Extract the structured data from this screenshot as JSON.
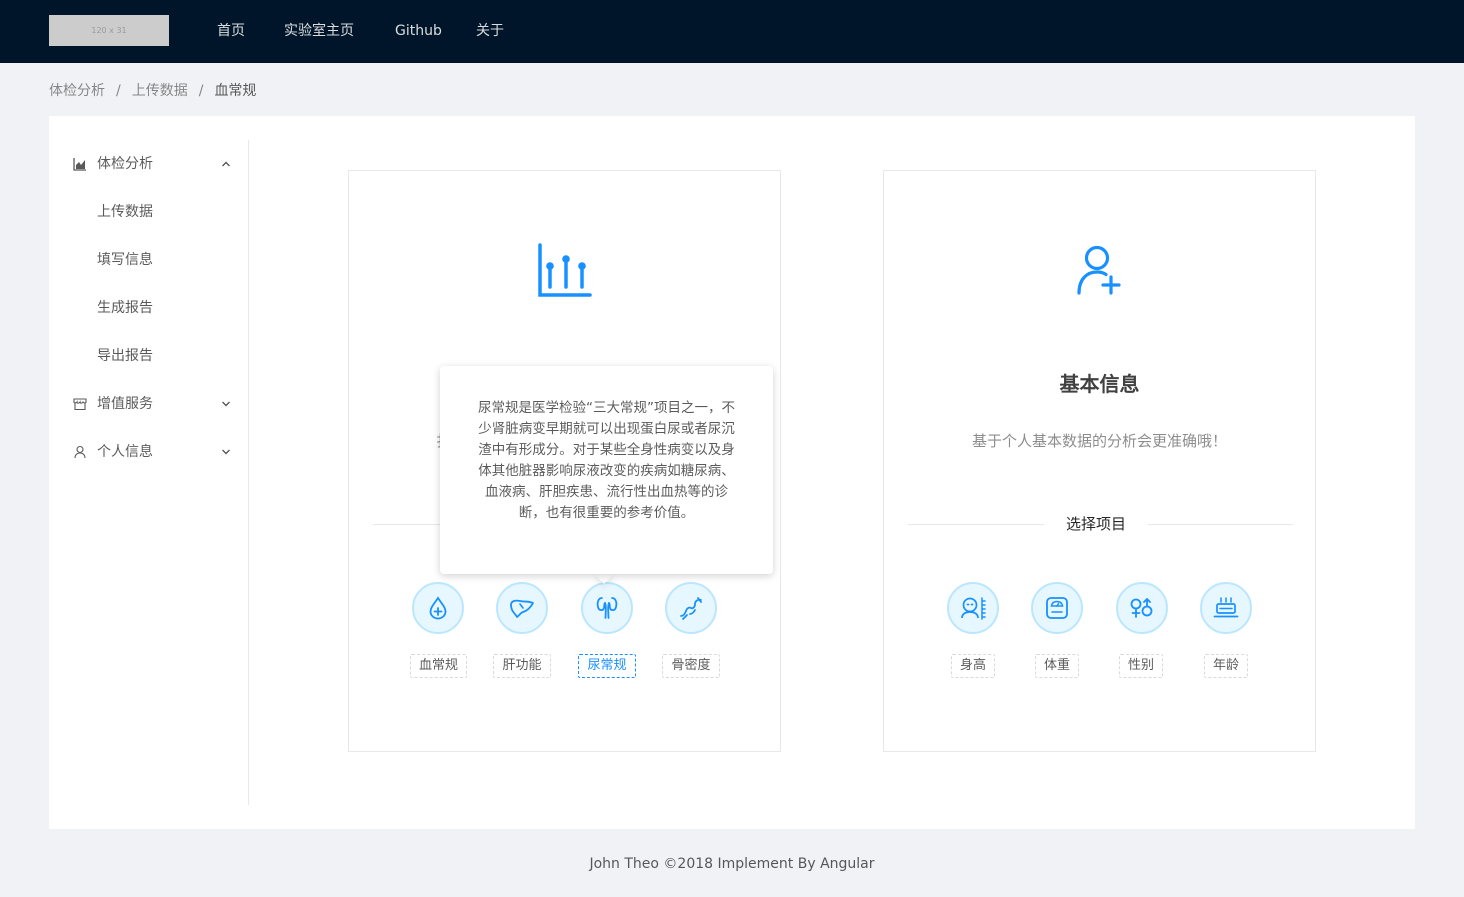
{
  "header": {
    "logo_text": "120 x 31",
    "nav": [
      "首页",
      "实验室主页",
      "Github",
      "关于"
    ],
    "background": "#001529"
  },
  "breadcrumb": [
    "体检分析",
    "上传数据",
    "血常规"
  ],
  "sidebar": {
    "groups": [
      {
        "label": "体检分析",
        "icon": "area-chart-icon",
        "expanded": true,
        "items": [
          {
            "label": "上传数据"
          },
          {
            "label": "填写信息"
          },
          {
            "label": "生成报告"
          },
          {
            "label": "导出报告"
          }
        ]
      },
      {
        "label": "增值服务",
        "icon": "shop-icon",
        "expanded": false
      },
      {
        "label": "个人信息",
        "icon": "user-icon",
        "expanded": false
      }
    ]
  },
  "cards": {
    "left": {
      "hidden_desc_fragment": "扌",
      "items": [
        {
          "label": "血常规",
          "icon": "blood-drop-icon"
        },
        {
          "label": "肝功能",
          "icon": "liver-icon"
        },
        {
          "label": "尿常规",
          "icon": "kidney-icon",
          "active": true
        },
        {
          "label": "骨密度",
          "icon": "bone-icon"
        }
      ]
    },
    "right": {
      "title": "基本信息",
      "desc": "基于个人基本数据的分析会更准确哦！",
      "divider": "选择项目",
      "items": [
        {
          "label": "身高",
          "icon": "height-icon"
        },
        {
          "label": "体重",
          "icon": "scale-icon"
        },
        {
          "label": "性别",
          "icon": "gender-icon"
        },
        {
          "label": "年龄",
          "icon": "birthday-cake-icon"
        }
      ]
    }
  },
  "tooltip": {
    "text": "尿常规是医学检验“三大常规”项目之一，不少肾脏病变早期就可以出现蛋白尿或者尿沉渣中有形成分。对于某些全身性病变以及身体其他脏器影响尿液改变的疾病如糖尿病、血液病、肝胆疾患、流行性出血热等的诊断，也有很重要的参考价值。"
  },
  "footer": {
    "text": "John Theo ©2018 Implement By Angular"
  },
  "colors": {
    "accent": "#1890ff",
    "icon_bg": "#e6f7ff",
    "icon_border": "#bae7ff"
  }
}
